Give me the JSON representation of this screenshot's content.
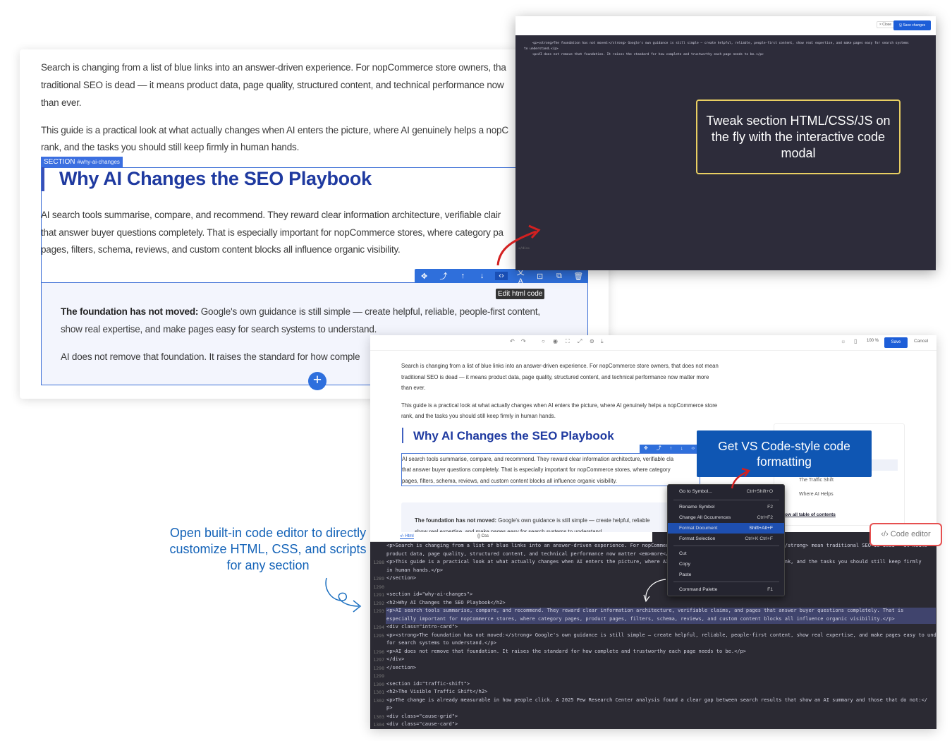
{
  "card1": {
    "para1": [
      "Search is changing from a list of blue links into an answer-driven experience. For nopCommerce store owners, tha",
      "traditional SEO is dead — it means product data, page quality, structured content, and technical performance now",
      "than ever."
    ],
    "para2": [
      "This guide is a practical look at what actually changes when AI enters the picture, where AI genuinely helps a nopC",
      "rank, and the tasks you should still keep firmly in human hands."
    ],
    "section_badge": "SECTION",
    "section_anchor": "#why-ai-changes",
    "heading": "Why AI Changes the SEO Playbook",
    "para3": [
      "AI search tools summarise, compare, and recommend. They reward clear information architecture, verifiable clair",
      "that answer buyer questions completely. That is especially important for nopCommerce stores, where category pa",
      "pages, filters, schema, reviews, and custom content blocks all influence organic visibility."
    ],
    "intro_bold": "The foundation has not moved:",
    "intro_rest": " Google's own guidance is still simple — create helpful, reliable, people-first content,",
    "intro_line2": "show real expertise, and make pages easy for search systems to understand.",
    "intro_line3": "AI does not remove that foundation. It raises the standard for how comple",
    "tooltip": "Edit html code",
    "toolbar_icons": [
      "✥",
      "⤴",
      "↑",
      "↓",
      "‹›",
      "文A",
      "⊡",
      "⧉",
      "🗑"
    ],
    "add_label": "+"
  },
  "modal": {
    "close": "× Close",
    "save": "🖫 Save changes",
    "code": [
      "<p><strong>The foundation has not moved:</strong> Google's own guidance is still simple — create helpful, reliable, people-first content, show real expertise, and make pages easy for search systems",
      "to understand.</p>",
      "<p>AI does not remove that foundation. It raises the standard for how complete and trustworthy each page needs to be.</p>"
    ],
    "footer": "</div>"
  },
  "callout1": "Tweak section HTML/CSS/JS on the fly with the interactive code modal",
  "card2": {
    "save": "Save",
    "cancel": "Cancel",
    "zoom": "100 %",
    "p1": [
      "Search is changing from a list of blue links into an answer-driven experience. For nopCommerce store owners, that does not mean",
      "traditional SEO is dead — it means product data, page quality, structured content, and technical performance now matter more",
      "than ever."
    ],
    "p2": [
      "This guide is a practical look at what actually changes when AI enters the picture, where AI genuinely helps a nopCommerce store",
      "rank, and the tasks you should still keep firmly in human hands."
    ],
    "heading": "Why AI Changes the SEO Playbook",
    "p3": [
      "AI search tools summarise, compare, and recommend. They reward clear information architecture, verifiable cla",
      "that answer buyer questions completely. That is especially important for nopCommerce stores, where category",
      "pages, filters, schema, reviews, and custom content blocks all influence organic visibility."
    ],
    "intro_bold": "The foundation has not moved:",
    "intro_rest": " Google's own guidance is still simple — create helpful, reliable",
    "intro_line2": "show real expertise, and make pages easy for search systems to understand",
    "toc": [
      "The Traffic Shift",
      "Where AI Helps",
      "ow all table of contents"
    ],
    "tabs": [
      "‹/› Html",
      "{} Css"
    ],
    "code_lines": [
      {
        "n": "",
        "c": "  <p>Search is changing from a list of blue links into an answer-driven experience. For nopCommerce store owners, that does <strong>not</strong> mean traditional SEO is dead — it means"
      },
      {
        "n": "",
        "c": "product data, page quality, structured content, and technical performance now matter <em>more</em>"
      },
      {
        "n": "1288",
        "c": "  <p>This guide is a practical look at what actually changes when AI enters the picture, where AI genuinely helps a nopCommerce store rank, and the tasks you should still keep firmly"
      },
      {
        "n": "",
        "c": "in human hands.</p>"
      },
      {
        "n": "1289",
        "c": "</section>"
      },
      {
        "n": "1290",
        "c": ""
      },
      {
        "n": "1291",
        "c": "<section id=\"why-ai-changes\">"
      },
      {
        "n": "1292",
        "c": "  <h2>Why AI Changes the SEO Playbook</h2>"
      },
      {
        "n": "1293",
        "c": "  <p>AI search tools summarise, compare, and recommend. They reward clear information architecture, verifiable claims, and pages that answer buyer questions completely. That is"
      },
      {
        "n": "",
        "c": "especially important for nopCommerce stores, where category pages, product pages, filters, schema, reviews, and custom content blocks all influence organic visibility.</p>"
      },
      {
        "n": "1294",
        "c": "  <div class=\"intro-card\">"
      },
      {
        "n": "1295",
        "c": "    <p><strong>The foundation has not moved:</strong> Google's own guidance is still simple — create helpful, reliable, people-first content, show real expertise, and make pages easy to understand"
      },
      {
        "n": "",
        "c": "for search systems to understand.</p>"
      },
      {
        "n": "1296",
        "c": "    <p>AI does not remove that foundation. It raises the standard for how complete and trustworthy each page needs to be.</p>"
      },
      {
        "n": "1297",
        "c": "  </div>"
      },
      {
        "n": "1298",
        "c": "</section>"
      },
      {
        "n": "1299",
        "c": ""
      },
      {
        "n": "1300",
        "c": "<section id=\"traffic-shift\">"
      },
      {
        "n": "1301",
        "c": "  <h2>The Visible Traffic Shift</h2>"
      },
      {
        "n": "1302",
        "c": "  <p>The change is already measurable in how people click. A 2025 Pew Research Center analysis found a clear gap between search results that show an AI summary and those that do not:</"
      },
      {
        "n": "",
        "c": "p>"
      },
      {
        "n": "1303",
        "c": "  <div class=\"cause-grid\">"
      },
      {
        "n": "1304",
        "c": "    <div class=\"cause-card\">"
      }
    ]
  },
  "context_menu": [
    {
      "label": "Go to Symbol...",
      "key": "Ctrl+Shift+O"
    },
    {
      "label": "Rename Symbol",
      "key": "F2"
    },
    {
      "label": "Change All Occurrences",
      "key": "Ctrl+F2"
    },
    {
      "label": "Format Document",
      "key": "Shift+Alt+F",
      "active": true
    },
    {
      "label": "Format Selection",
      "key": "Ctrl+K Ctrl+F"
    },
    {
      "label": "Cut",
      "key": ""
    },
    {
      "label": "Copy",
      "key": ""
    },
    {
      "label": "Paste",
      "key": ""
    },
    {
      "label": "Command Palette",
      "key": "F1"
    }
  ],
  "callout2": "Get VS Code-style code formatting",
  "code_editor_btn": "‹/› Code editor",
  "left_callout": "Open built-in code editor to directly customize HTML, CSS, and scripts for any section",
  "colors": {
    "accent": "#1d5ed8",
    "heading": "#1f3aa0",
    "callout_border": "#e9cf62",
    "arrow": "#d32020"
  }
}
